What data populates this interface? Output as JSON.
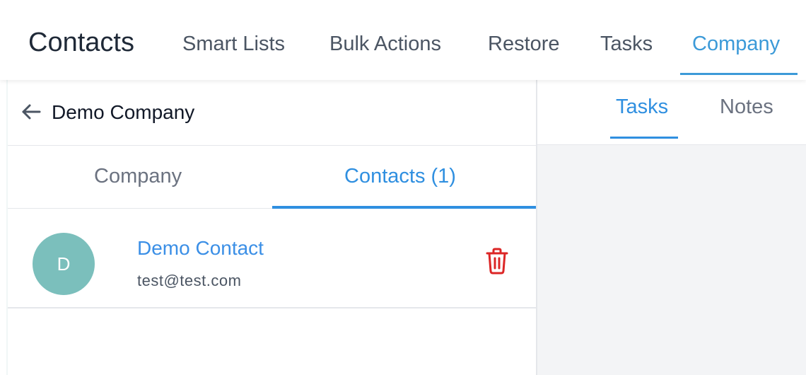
{
  "header": {
    "title": "Contacts",
    "nav": {
      "smart_lists": "Smart Lists",
      "bulk_actions": "Bulk Actions",
      "restore": "Restore",
      "tasks": "Tasks",
      "company": "Company"
    },
    "active_tab": "Company"
  },
  "company": {
    "name": "Demo Company",
    "back_icon": "arrow-left-icon"
  },
  "company_tabs": {
    "company": "Company",
    "contacts": "Contacts (1)",
    "active_tab": "Contacts (1)"
  },
  "contacts": [
    {
      "avatar_initial": "D",
      "name": "Demo Contact",
      "email": "test@test.com",
      "delete_icon": "trash-icon"
    }
  ],
  "side_tabs": {
    "tasks": "Tasks",
    "notes": "Notes",
    "active_tab": "Tasks"
  },
  "colors": {
    "accent": "#3c9ad8",
    "link": "#3b8fe6",
    "avatar": "#7bbfbc",
    "danger": "#dc2626",
    "panel_bg": "#f3f4f6"
  }
}
